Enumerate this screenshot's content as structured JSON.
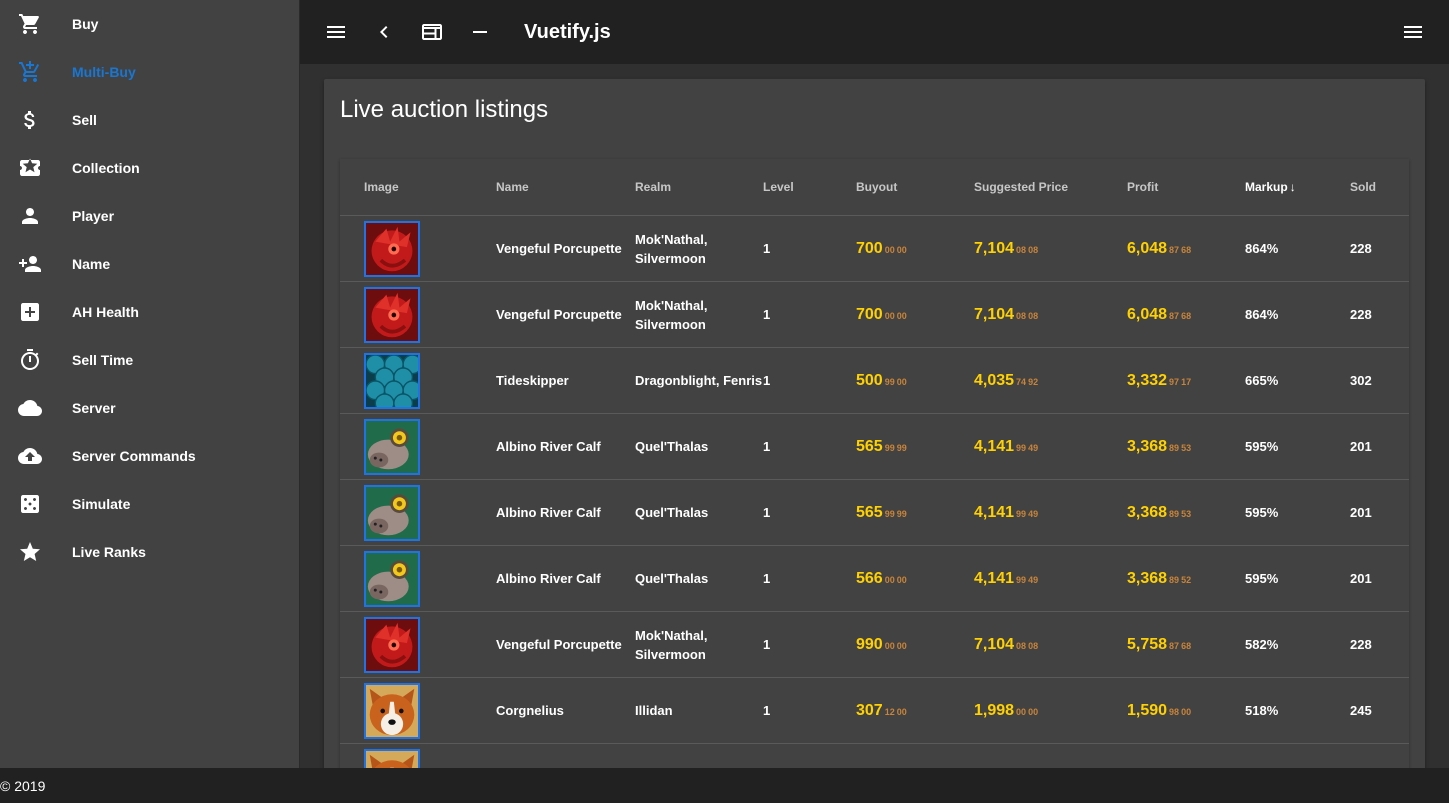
{
  "sidebar": {
    "items": [
      {
        "label": "Buy",
        "icon": "cart-icon"
      },
      {
        "label": "Multi-Buy",
        "icon": "cart-plus-icon",
        "active": true
      },
      {
        "label": "Sell",
        "icon": "dollar-icon"
      },
      {
        "label": "Collection",
        "icon": "ticket-star-icon"
      },
      {
        "label": "Player",
        "icon": "person-icon"
      },
      {
        "label": "Name",
        "icon": "person-add-icon"
      },
      {
        "label": "AH Health",
        "icon": "medical-plus-icon"
      },
      {
        "label": "Sell Time",
        "icon": "timer-icon"
      },
      {
        "label": "Server",
        "icon": "cloud-icon"
      },
      {
        "label": "Server Commands",
        "icon": "cloud-upload-icon"
      },
      {
        "label": "Simulate",
        "icon": "dice-icon"
      },
      {
        "label": "Live Ranks",
        "icon": "star-icon"
      }
    ]
  },
  "toolbar": {
    "title": "Vuetify.js"
  },
  "card": {
    "title": "Live auction listings"
  },
  "table": {
    "headers": {
      "image": "Image",
      "name": "Name",
      "realm": "Realm",
      "level": "Level",
      "buyout": "Buyout",
      "suggested": "Suggested Price",
      "profit": "Profit",
      "markup": "Markup",
      "sold": "Sold"
    },
    "sort_indicator": "↓",
    "rows": [
      {
        "pet": "porcupette",
        "name": "Vengeful Porcupette",
        "realm": "Mok'Nathal, Silvermoon",
        "level": "1",
        "buyout": {
          "g": "700",
          "s": "00",
          "c": "00"
        },
        "suggested": {
          "g": "7,104",
          "s": "08",
          "c": "08"
        },
        "profit": {
          "g": "6,048",
          "s": "87",
          "c": "68"
        },
        "markup": "864%",
        "sold": "228"
      },
      {
        "pet": "porcupette",
        "name": "Vengeful Porcupette",
        "realm": "Mok'Nathal, Silvermoon",
        "level": "1",
        "buyout": {
          "g": "700",
          "s": "00",
          "c": "00"
        },
        "suggested": {
          "g": "7,104",
          "s": "08",
          "c": "08"
        },
        "profit": {
          "g": "6,048",
          "s": "87",
          "c": "68"
        },
        "markup": "864%",
        "sold": "228"
      },
      {
        "pet": "tideskipper",
        "name": "Tideskipper",
        "realm": "Dragonblight, Fenris",
        "level": "1",
        "buyout": {
          "g": "500",
          "s": "99",
          "c": "00"
        },
        "suggested": {
          "g": "4,035",
          "s": "74",
          "c": "92"
        },
        "profit": {
          "g": "3,332",
          "s": "97",
          "c": "17"
        },
        "markup": "665%",
        "sold": "302"
      },
      {
        "pet": "calf",
        "name": "Albino River Calf",
        "realm": "Quel'Thalas",
        "level": "1",
        "buyout": {
          "g": "565",
          "s": "99",
          "c": "99"
        },
        "suggested": {
          "g": "4,141",
          "s": "99",
          "c": "49"
        },
        "profit": {
          "g": "3,368",
          "s": "89",
          "c": "53"
        },
        "markup": "595%",
        "sold": "201"
      },
      {
        "pet": "calf",
        "name": "Albino River Calf",
        "realm": "Quel'Thalas",
        "level": "1",
        "buyout": {
          "g": "565",
          "s": "99",
          "c": "99"
        },
        "suggested": {
          "g": "4,141",
          "s": "99",
          "c": "49"
        },
        "profit": {
          "g": "3,368",
          "s": "89",
          "c": "53"
        },
        "markup": "595%",
        "sold": "201"
      },
      {
        "pet": "calf",
        "name": "Albino River Calf",
        "realm": "Quel'Thalas",
        "level": "1",
        "buyout": {
          "g": "566",
          "s": "00",
          "c": "00"
        },
        "suggested": {
          "g": "4,141",
          "s": "99",
          "c": "49"
        },
        "profit": {
          "g": "3,368",
          "s": "89",
          "c": "52"
        },
        "markup": "595%",
        "sold": "201"
      },
      {
        "pet": "porcupette",
        "name": "Vengeful Porcupette",
        "realm": "Mok'Nathal, Silvermoon",
        "level": "1",
        "buyout": {
          "g": "990",
          "s": "00",
          "c": "00"
        },
        "suggested": {
          "g": "7,104",
          "s": "08",
          "c": "08"
        },
        "profit": {
          "g": "5,758",
          "s": "87",
          "c": "68"
        },
        "markup": "582%",
        "sold": "228"
      },
      {
        "pet": "corgi",
        "name": "Corgnelius",
        "realm": "Illidan",
        "level": "1",
        "buyout": {
          "g": "307",
          "s": "12",
          "c": "00"
        },
        "suggested": {
          "g": "1,998",
          "s": "00",
          "c": "00"
        },
        "profit": {
          "g": "1,590",
          "s": "98",
          "c": "00"
        },
        "markup": "518%",
        "sold": "245"
      },
      {
        "pet": "corgi",
        "name": "",
        "realm": "",
        "level": "",
        "buyout": null,
        "suggested": null,
        "profit": null,
        "markup": "",
        "sold": ""
      }
    ]
  },
  "footer": {
    "text": "© 2019"
  },
  "colors": {
    "accent": "#1976d2",
    "gold": "#ffd100",
    "copper": "#c8843a"
  }
}
